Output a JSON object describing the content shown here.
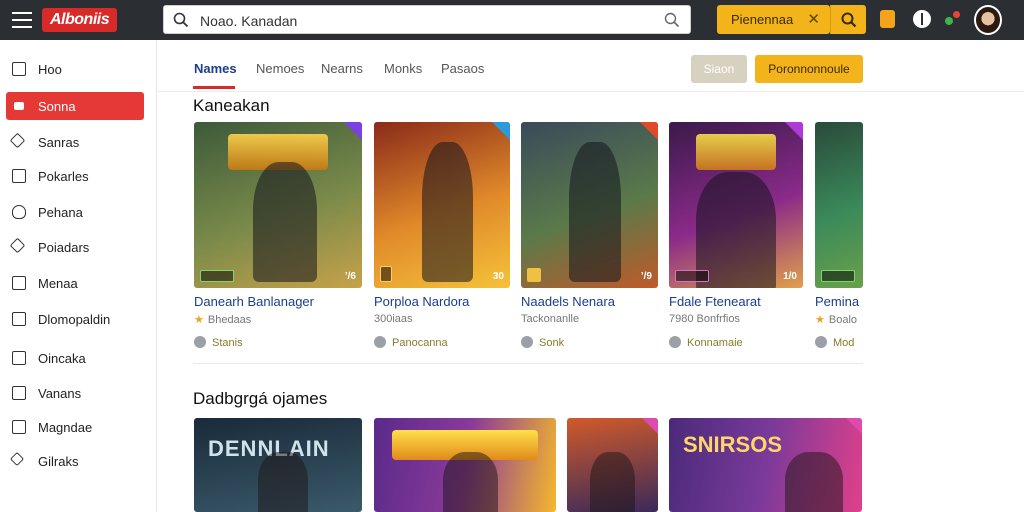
{
  "app": {
    "logo_text": "Alboniis"
  },
  "search": {
    "value": "Noao. Kanadan"
  },
  "header": {
    "promo_label": "Pienennaa",
    "promo_close": "✕"
  },
  "sidebar": {
    "items": [
      {
        "label": "Hoo",
        "icon": "box-icon"
      },
      {
        "label": "Sonna",
        "icon": "box-icon",
        "active": true
      },
      {
        "label": "Sanras",
        "icon": "diamond-icon"
      },
      {
        "label": "Pokarles",
        "icon": "box-icon"
      },
      {
        "label": "Pehana",
        "icon": "shield-icon"
      },
      {
        "label": "Poiadars",
        "icon": "star-icon"
      },
      {
        "label": "Menaa",
        "icon": "edit-icon"
      },
      {
        "label": "Dlomopaldin",
        "icon": "doc-icon"
      },
      {
        "label": "Oincaka",
        "icon": "box-icon"
      },
      {
        "label": "Vanans",
        "icon": "edit-icon"
      },
      {
        "label": "Magndae",
        "icon": "box-icon"
      },
      {
        "label": "Gilraks",
        "icon": "sparkle-icon"
      }
    ]
  },
  "tabs": [
    {
      "label": "Names",
      "active": true
    },
    {
      "label": "Nemoes"
    },
    {
      "label": "Nearns"
    },
    {
      "label": "Monks"
    },
    {
      "label": "Pasaos"
    }
  ],
  "buttons": {
    "grey": "Siaon",
    "yellow": "Poronnonnoule"
  },
  "section1": {
    "title": "Kaneakan",
    "cards": [
      {
        "title": "Danearh Banlanager",
        "meta": "Bhedaas",
        "foot": "Stanis",
        "corner_r": "’/6",
        "colors": [
          "#3c5a3a",
          "#7a8a4a",
          "#c6a24a"
        ]
      },
      {
        "title": "Porploa Nardora",
        "meta": "300iaas",
        "foot": "Panocanna",
        "corner_r": "30",
        "colors": [
          "#8a2a1a",
          "#e08a2a",
          "#f5c23a"
        ]
      },
      {
        "title": "Naadels Nenara",
        "meta": "Tackonanlle",
        "foot": "Sonk",
        "corner_r": "’/9",
        "colors": [
          "#3a4a5a",
          "#5a7a4a",
          "#c05a2a"
        ]
      },
      {
        "title": "Fdale Ftenearat",
        "meta": "7980 Bonfrfios",
        "foot": "Konnamaie",
        "corner_r": "1/0",
        "colors": [
          "#3a1a4a",
          "#8a2a8a",
          "#e0a04a"
        ]
      },
      {
        "title": "Pemina",
        "meta": "Boalo",
        "foot": "Mod",
        "corner_r": "",
        "colors": [
          "#2a4a3a",
          "#3a8a5a",
          "#6aa04a"
        ]
      }
    ]
  },
  "section2": {
    "title": "Dadbgrgá ojames",
    "cards": [
      {
        "art_text": "DENNLAIN",
        "colors": [
          "#1a2a3a",
          "#3a5a6a"
        ]
      },
      {
        "art_text": "",
        "colors": [
          "#5a2a8a",
          "#f5b82a"
        ]
      },
      {
        "art_text": "",
        "colors": [
          "#d05a2a",
          "#3a2a5a"
        ]
      },
      {
        "art_text": "SNIRSOS",
        "colors": [
          "#4a2a7a",
          "#e0408a"
        ]
      }
    ]
  }
}
